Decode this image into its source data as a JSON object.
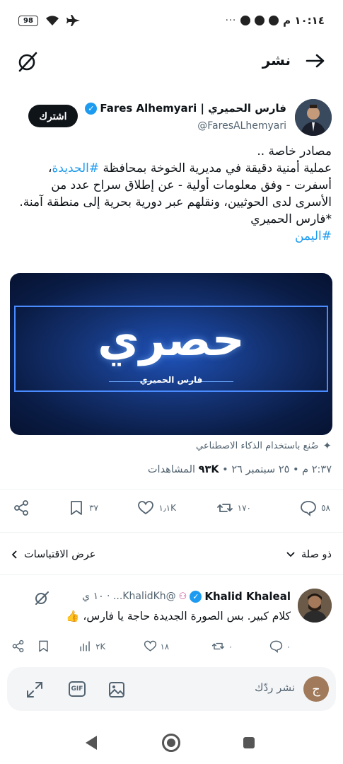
{
  "status_bar": {
    "time": "١٠:١٤ م",
    "more_dots": "···",
    "battery": "98"
  },
  "topbar": {
    "title": "نشر"
  },
  "tweet": {
    "author_name": "فارس الحميري | Fares Alhemyari",
    "author_handle": "@FaresALhemyari",
    "subscribe_label": "اشترك",
    "text_lines": [
      {
        "text": "مصادر خاصة .."
      },
      {
        "before": "عملية أمنية دقيقة في مديرية الخوخة بمحافظة ",
        "tag": "#الحديدة",
        "after": "،"
      },
      {
        "text": "أسفرت - وفق معلومات أولية - عن إطلاق سراح عدد من"
      },
      {
        "text": "الأسرى لدى الحوثيين، ونقلهم عبر دورية بحرية إلى منطقة آمنة."
      },
      {
        "text": "*فارس الحميري"
      }
    ],
    "hashtag_last": "#اليمن",
    "media": {
      "title": "حصري",
      "subtitle": "فارس الحميري"
    },
    "ai_note": "صُنع باستخدام الذكاء الاصطناعي",
    "meta": {
      "time_date": "٢:٣٧ م • ٢٥ سبتمبر ٢٦ • ",
      "views_count": "٩٣K",
      "views_label": " المشاهدات"
    },
    "stats": {
      "replies": "٥٨",
      "reposts": "١٧٠",
      "likes": "١٫١K",
      "bookmarks": "٣٧"
    }
  },
  "sort_bar": {
    "relevance": "ذو صلة",
    "quotes": "عرض الاقتباسات"
  },
  "reply": {
    "name": "Khalid Khaleal",
    "handle": "@KhalidKh... · ١٠ ي",
    "text": "كلام كبير. بس الصورة الجديدة حاجة يا فارس، 👍",
    "stats": {
      "replies": "٠",
      "reposts": "٠",
      "likes": "١٨",
      "views": "٢K"
    }
  },
  "composer": {
    "avatar_letter": "ج",
    "placeholder": "نشر ردّك",
    "gif_label": "GIF"
  },
  "colors": {
    "accent": "#1d9bf0",
    "text": "#0f1419",
    "muted": "#536471"
  }
}
